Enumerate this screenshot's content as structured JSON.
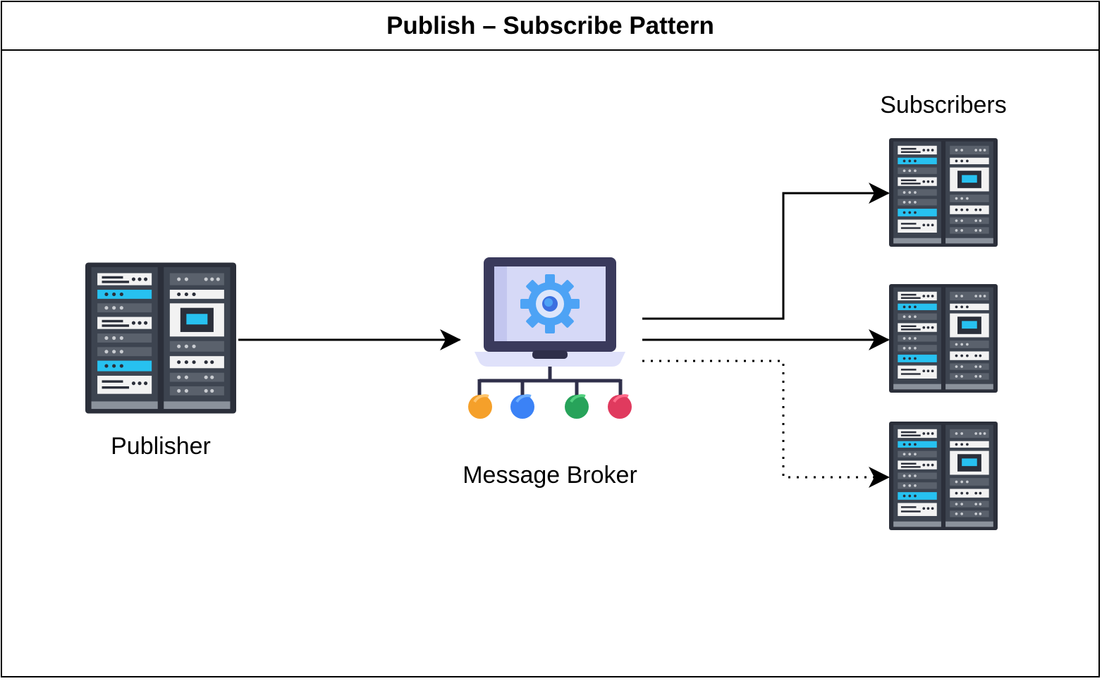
{
  "diagram": {
    "title": "Publish – Subscribe Pattern",
    "nodes": {
      "publisher": {
        "label": "Publisher",
        "icon": "server-rack-icon"
      },
      "broker": {
        "label": "Message Broker",
        "icon": "laptop-gear-network-icon"
      },
      "subscribers": {
        "label": "Subscribers",
        "icon": "server-rack-icon",
        "count": 3
      }
    },
    "edges": [
      {
        "from": "publisher",
        "to": "broker",
        "style": "solid"
      },
      {
        "from": "broker",
        "to": "subscriber-1",
        "style": "solid"
      },
      {
        "from": "broker",
        "to": "subscriber-2",
        "style": "solid"
      },
      {
        "from": "broker",
        "to": "subscriber-3",
        "style": "dotted"
      }
    ],
    "colors": {
      "rack_dark": "#2b2f3a",
      "rack_panel": "#3d4450",
      "rack_slot": "#f2f2f2",
      "rack_cyan": "#27c1f0",
      "laptop_frame": "#3a3a5c",
      "laptop_screen": "#d6d9f7",
      "gear": "#4da3f5",
      "dot_orange": "#f5a02a",
      "dot_blue": "#3b82f6",
      "dot_green": "#27a35a",
      "dot_red": "#e03a5e"
    }
  }
}
